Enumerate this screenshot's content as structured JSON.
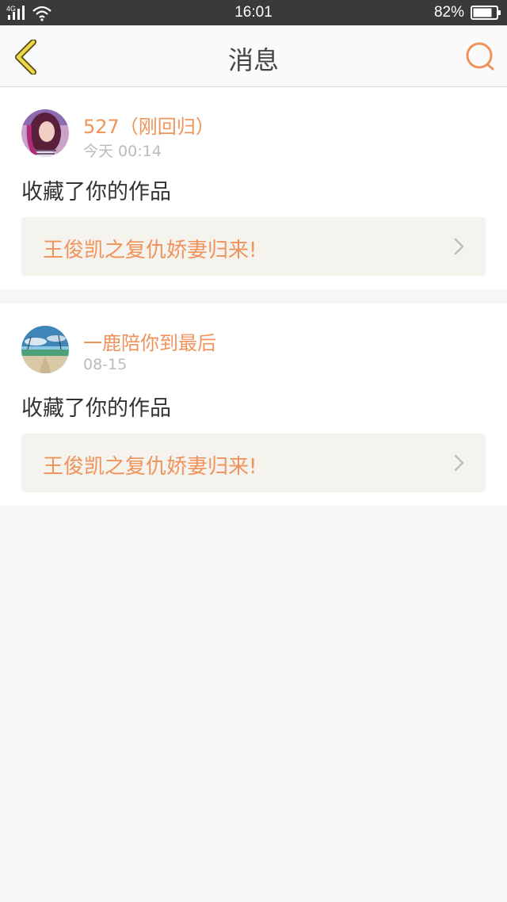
{
  "status_bar": {
    "network": "4G",
    "time": "16:01",
    "battery": "82%",
    "battery_level": 0.82
  },
  "nav": {
    "title": "消息",
    "back_icon": "chevron-left-icon",
    "search_icon": "search-icon",
    "accent_color": "#f0935b",
    "back_color": "#e8d84a"
  },
  "messages": [
    {
      "user": "527（刚回归）",
      "time": "今天 00:14",
      "action": "收藏了你的作品",
      "work_title": "王俊凯之复仇娇妻归来!"
    },
    {
      "user": "一鹿陪你到最后",
      "time": "08-15",
      "action": "收藏了你的作品",
      "work_title": "王俊凯之复仇娇妻归来!"
    }
  ]
}
